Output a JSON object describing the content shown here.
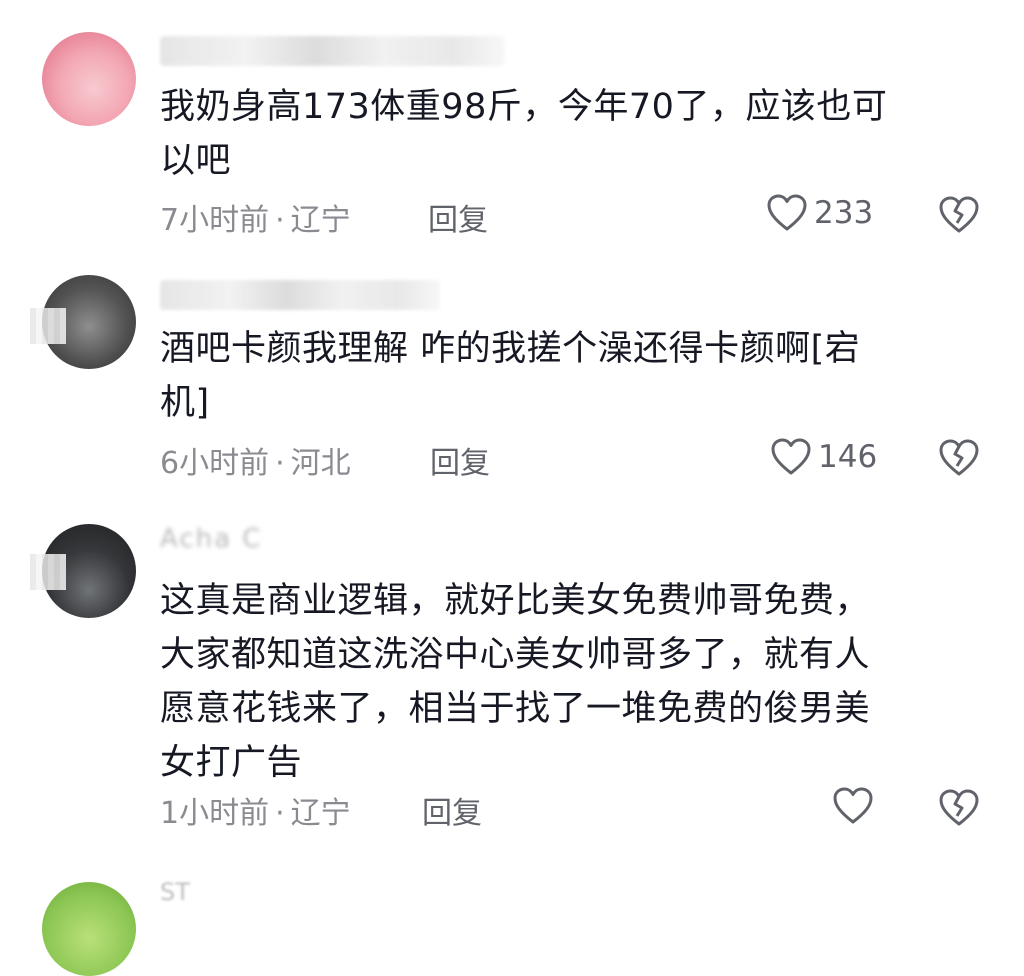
{
  "comments": [
    {
      "text": "我奶身高173体重98斤，今年70了，应该也可\n以吧",
      "time": "7小时前",
      "location": "辽宁",
      "meta_separator": "·",
      "reply_label": "回复",
      "likes": "233"
    },
    {
      "text": "酒吧卡颜我理解 咋的我搓个澡还得卡颜啊[宕\n机]",
      "time": "6小时前",
      "location": "河北",
      "meta_separator": "·",
      "reply_label": "回复",
      "likes": "146"
    },
    {
      "username": "Acha C",
      "text": "这真是商业逻辑，就好比美女免费帅哥免费，\n大家都知道这洗浴中心美女帅哥多了，就有人\n愿意花钱来了，相当于找了一堆免费的俊男美\n女打广告",
      "time": "1小时前",
      "location": "辽宁",
      "meta_separator": "·",
      "reply_label": "回复",
      "likes": ""
    }
  ],
  "next_comment": {
    "username": "ST"
  },
  "icons": {
    "like": "heart-outline-icon",
    "dislike": "broken-heart-icon"
  },
  "colors": {
    "text": "#161823",
    "meta": "#8a8b91",
    "action": "#61636b"
  }
}
